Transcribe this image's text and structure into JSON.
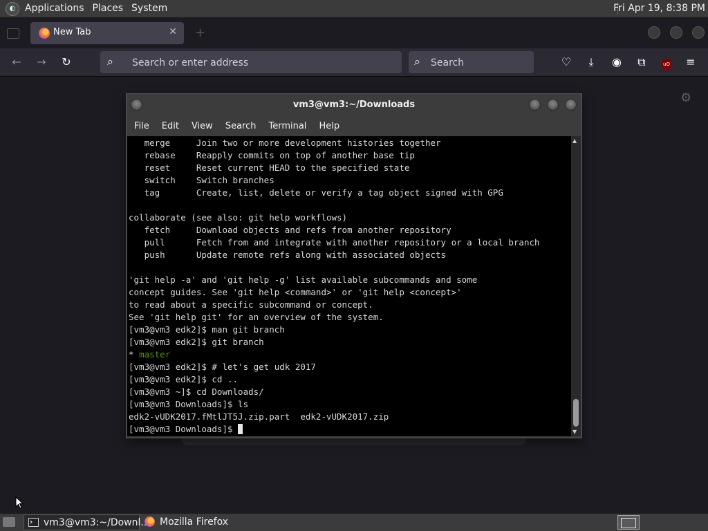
{
  "top_panel": {
    "menus": [
      "Applications",
      "Places",
      "System"
    ],
    "clock": "Fri Apr 19,  8:38 PM"
  },
  "browser": {
    "tab_title": "New Tab",
    "url_placeholder": "Search or enter address",
    "search_placeholder": "Search",
    "accent_color": "#42414d"
  },
  "terminal": {
    "title": "vm3@vm3:~/Downloads",
    "menu": [
      "File",
      "Edit",
      "View",
      "Search",
      "Terminal",
      "Help"
    ],
    "lines": [
      "   merge     Join two or more development histories together",
      "   rebase    Reapply commits on top of another base tip",
      "   reset     Reset current HEAD to the specified state",
      "   switch    Switch branches",
      "   tag       Create, list, delete or verify a tag object signed with GPG",
      "",
      "collaborate (see also: git help workflows)",
      "   fetch     Download objects and refs from another repository",
      "   pull      Fetch from and integrate with another repository or a local branch",
      "   push      Update remote refs along with associated objects",
      "",
      "'git help -a' and 'git help -g' list available subcommands and some",
      "concept guides. See 'git help <command>' or 'git help <concept>'",
      "to read about a specific subcommand or concept.",
      "See 'git help git' for an overview of the system.",
      "[vm3@vm3 edk2]$ man git branch",
      "[vm3@vm3 edk2]$ git branch",
      "* ",
      "[vm3@vm3 edk2]$ # let's get udk 2017",
      "[vm3@vm3 edk2]$ cd ..",
      "[vm3@vm3 ~]$ cd Downloads/",
      "[vm3@vm3 Downloads]$ ls",
      "edk2-vUDK2017.fMtlJT5J.zip.part  edk2-vUDK2017.zip",
      "[vm3@vm3 Downloads]$ "
    ],
    "branch_name": "master",
    "branch_color": "#4e9a06"
  },
  "taskbar": {
    "tasks": [
      "vm3@vm3:~/Downl...",
      "Mozilla Firefox"
    ]
  }
}
